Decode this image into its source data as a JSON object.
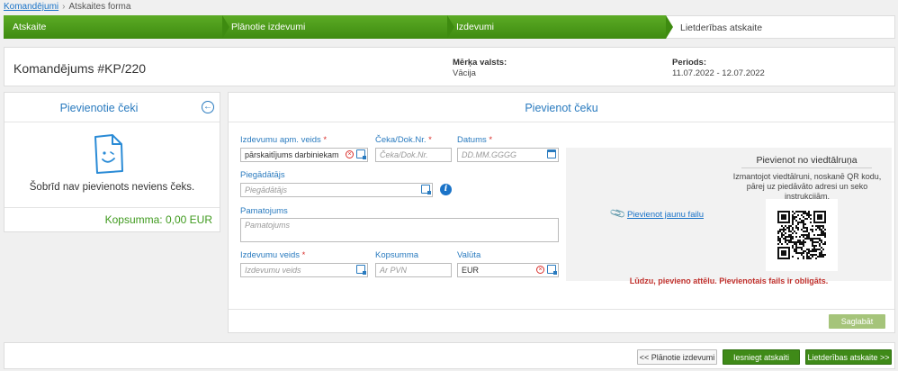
{
  "breadcrumb": {
    "link": "Komandējumi",
    "separator": "›",
    "current": "Atskaites forma"
  },
  "steps": [
    "Atskaite",
    "Plānotie izdevumi",
    "Izdevumi",
    "Lietderības atskaite"
  ],
  "header": {
    "title": "Komandējums #KP/220",
    "country_label": "Mērķa valsts:",
    "country_value": "Vācija",
    "period_label": "Periods:",
    "period_value": "11.07.2022 - 12.07.2022"
  },
  "receipts": {
    "title": "Pievienotie čeki",
    "empty": "Šobrīd nav pievienots neviens čeks.",
    "total": "Kopsumma: 0,00 EUR"
  },
  "form": {
    "title": "Pievienot čeku",
    "payment_type": {
      "label": "Izdevumu apm. veids",
      "value": "pārskaitījums darbiniekam"
    },
    "receipt_no": {
      "label": "Čeka/Dok.Nr.",
      "placeholder": "Čeka/Dok.Nr."
    },
    "date": {
      "label": "Datums",
      "placeholder": "DD.MM.GGGG"
    },
    "supplier": {
      "label": "Piegādātājs",
      "placeholder": "Piegādātājs"
    },
    "basis": {
      "label": "Pamatojums",
      "placeholder": "Pamatojums"
    },
    "expense_type": {
      "label": "Izdevumu veids",
      "placeholder": "Izdevumu veids"
    },
    "amount": {
      "label": "Kopsumma",
      "placeholder": "Ar PVN"
    },
    "currency": {
      "label": "Valūta",
      "value": "EUR"
    },
    "required_mark": "*",
    "info_glyph": "i",
    "attach_link": "Pievienot jaunu failu",
    "phone_title": "Pievienot no viedtālruņa",
    "phone_desc": "Izmantojot viedtālruni, noskanē QR kodu, pārej uz piedāvāto adresi un seko instrukcijām.",
    "error": "Lūdzu, pievieno attēlu. Pievienotais fails ir obligāts.",
    "save": "Saglabāt"
  },
  "footer": {
    "back": "<< Plānotie izdevumi",
    "submit": "Iesniegt atskaiti",
    "next": "Lietderības atskaite >>"
  },
  "colors": {
    "accent_green": "#3e8b10",
    "link_blue": "#1a73c8",
    "label_blue": "#2a7bbf",
    "error_red": "#c0302c"
  },
  "icons": [
    "back-circle-icon",
    "receipt-doc-icon",
    "clear-icon",
    "picker-icon",
    "calendar-icon",
    "info-icon",
    "paperclip-icon",
    "qr-code-icon"
  ]
}
